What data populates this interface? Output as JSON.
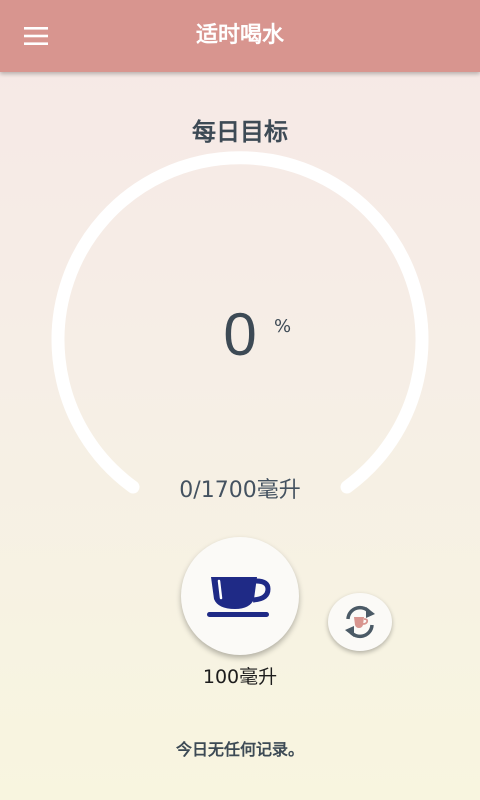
{
  "appbar": {
    "title": "适时喝水",
    "menu_icon": "hamburger-menu-icon",
    "color": "#d8958f"
  },
  "goal": {
    "title": "每日目标",
    "percent": "0",
    "percent_sign": "%",
    "progress_text": "0/1700毫升",
    "progress_fraction": 0
  },
  "actions": {
    "drink_icon": "coffee-cup-icon",
    "cup_amount": "100毫升",
    "switch_icon": "switch-cup-icon"
  },
  "records": {
    "empty_text": "今日无任何记录。"
  },
  "colors": {
    "cup_blue": "#1f2a86",
    "switch_arrows": "#4b5a66",
    "switch_cup": "#d8958f",
    "ring": "#ffffff"
  }
}
